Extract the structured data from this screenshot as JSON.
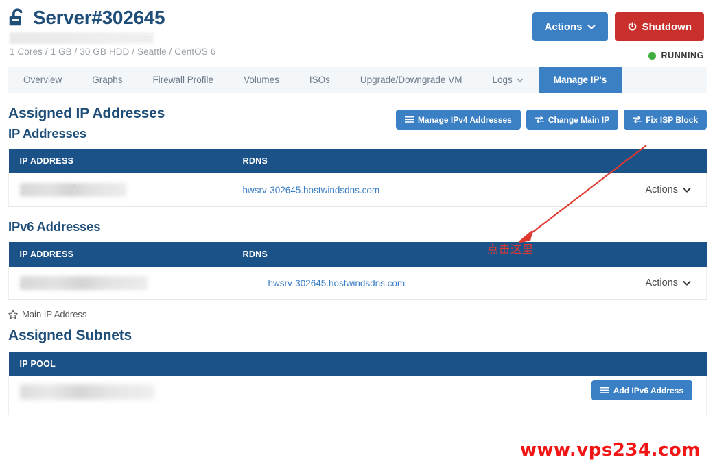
{
  "header": {
    "lock_icon": "unlock-icon",
    "title": "Server#302645",
    "hostname_redacted": "sdns.com",
    "specs": "1 Cores / 1 GB / 30 GB HDD / Seattle / CentOS 6",
    "actions_button": "Actions",
    "shutdown_button": "Shutdown",
    "status": "RUNNING",
    "status_color": "#3fae3f"
  },
  "tabs": [
    {
      "label": "Overview",
      "active": false,
      "caret": false
    },
    {
      "label": "Graphs",
      "active": false,
      "caret": false
    },
    {
      "label": "Firewall Profile",
      "active": false,
      "caret": false
    },
    {
      "label": "Volumes",
      "active": false,
      "caret": false
    },
    {
      "label": "ISOs",
      "active": false,
      "caret": false
    },
    {
      "label": "Upgrade/Downgrade VM",
      "active": false,
      "caret": false
    },
    {
      "label": "Logs",
      "active": false,
      "caret": true
    },
    {
      "label": "Manage IP's",
      "active": true,
      "caret": false
    }
  ],
  "assigned_ip": {
    "section_title": "Assigned IP Addresses",
    "sub_title": "IP Addresses",
    "toolbar": [
      {
        "label": "Manage IPv4 Addresses",
        "icon": "list-icon"
      },
      {
        "label": "Change Main IP",
        "icon": "swap-icon"
      },
      {
        "label": "Fix ISP Block",
        "icon": "swap-icon"
      }
    ],
    "columns": [
      "IP ADDRESS",
      "RDNS",
      ""
    ],
    "rows": [
      {
        "ip": "169.140.22",
        "ip_redacted": true,
        "is_main": true,
        "rdns": "hwsrv-302645.hostwindsdns.com",
        "actions_label": "Actions"
      }
    ]
  },
  "ipv6": {
    "sub_title": "IPv6 Addresses",
    "columns": [
      "IP ADDRESS",
      "RDNS",
      ""
    ],
    "rows": [
      {
        "ip": "2a",
        "ip_redacted": true,
        "is_main": false,
        "rdns": "hwsrv-302645.hostwindsdns.com",
        "actions_label": "Actions"
      }
    ]
  },
  "legend": {
    "star_icon": "star-outline-icon",
    "label": "Main IP Address"
  },
  "subnets": {
    "section_title": "Assigned Subnets",
    "columns": [
      "IP POOL"
    ],
    "rows": [
      {
        "pool": "",
        "pool_redacted": true
      }
    ],
    "add_button": {
      "label": "Add IPv6 Address",
      "icon": "list-icon"
    }
  },
  "annotations": {
    "callout_text": "点击这里",
    "callout_color": "#e03b34",
    "watermark": "www.vps234.com",
    "watermark_color": "#f01616"
  },
  "theme": {
    "primary_blue": "#3b80c4",
    "table_header_blue": "#1b5288",
    "title_blue": "#1f4e79",
    "danger_red": "#c9302c",
    "link_blue": "#3b7dc4"
  }
}
